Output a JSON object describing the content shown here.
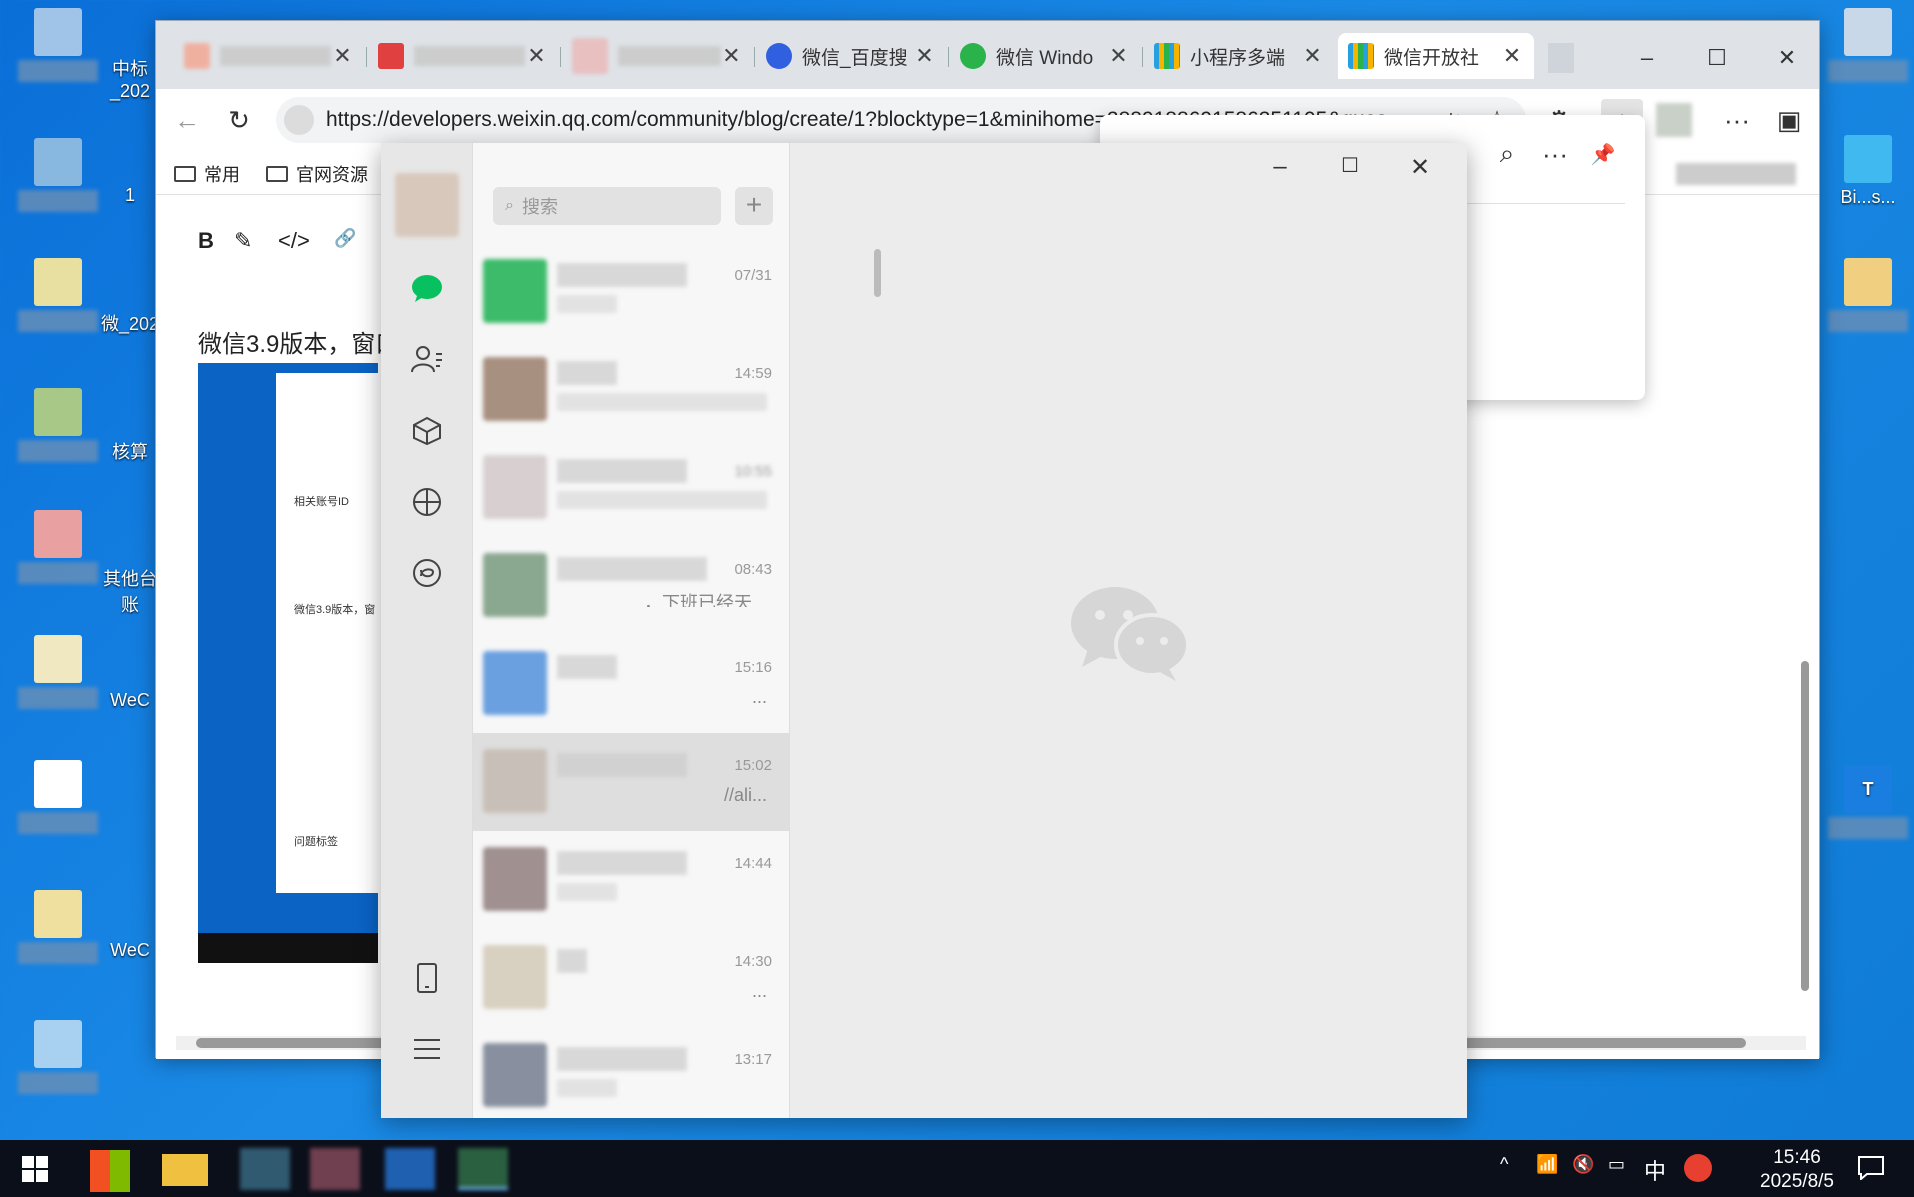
{
  "desktop": {
    "icons_left_col1": [
      "",
      "",
      "",
      "",
      "",
      "",
      "",
      ""
    ],
    "icons_left_col2": [
      "中标_202",
      "1",
      "微_202",
      "核算",
      "其他台账",
      "WeC",
      "WeC"
    ],
    "icons_right": [
      "Bi...s...",
      "T"
    ]
  },
  "browser": {
    "tabs": [
      {
        "title": "",
        "color": "#f0b0a0"
      },
      {
        "title": "",
        "color": "#e04040"
      },
      {
        "title": "",
        "color": "#e8c0c0"
      },
      {
        "title": "微信_百度搜",
        "color": "#3060e0"
      },
      {
        "title": "微信 Windo",
        "color": "#2ab34a"
      },
      {
        "title": "小程序多端",
        "color": "#27a0e0"
      },
      {
        "title": "微信开放社",
        "color": "#27a0e0"
      }
    ],
    "url": "https://developers.weixin.qq.com/community/blog/create/1?blocktype=1&minihome=2889188691586351105&ques...",
    "bookmarks": [
      "常用",
      "官网资源"
    ],
    "toolbar": {
      "back": "←",
      "reload": "↻",
      "translate": "aあ",
      "star": "☆",
      "ext": "⚙",
      "download": "↓",
      "more": "···",
      "sidebar": "▣"
    },
    "editor": {
      "bold": "B",
      "pen": "✎",
      "code": "</>",
      "link": "🔗",
      "post_text": "微信3.9版本，窗口",
      "shot_field_label": "相关账号ID",
      "shot_text": "微信3.9版本，窗",
      "shot_tags": "问题标签"
    },
    "popup_icons": {
      "search": "⌕",
      "more": "···",
      "pin": "📌"
    }
  },
  "wechat": {
    "search_placeholder": "搜索",
    "add": "+",
    "chats": [
      {
        "time": "07/31",
        "msg": "",
        "color": "#3dbb6b"
      },
      {
        "time": "14:59",
        "msg": "",
        "color": "#a89080"
      },
      {
        "time": "10:55",
        "msg": "",
        "color": "#d8d0d0"
      },
      {
        "time": "08:43",
        "msg": "，下班已经天...",
        "color": "#8aa890"
      },
      {
        "time": "15:16",
        "msg": "...",
        "color": "#6aa0e0"
      },
      {
        "time": "15:02",
        "msg": "//ali...",
        "color": "#c8c0b8"
      },
      {
        "time": "14:44",
        "msg": "",
        "color": "#a09090"
      },
      {
        "time": "14:30",
        "msg": "...",
        "color": "#d8d0c0"
      },
      {
        "time": "13:17",
        "msg": "",
        "color": "#8890a0"
      }
    ],
    "controls": {
      "min": "–",
      "max": "☐",
      "close": "✕"
    }
  },
  "taskbar": {
    "time": "15:46",
    "date": "2025/8/5",
    "ime": "中",
    "tray": {
      "up": "^",
      "wifi": "📶",
      "mute": "🔇",
      "battery": "▭"
    }
  }
}
